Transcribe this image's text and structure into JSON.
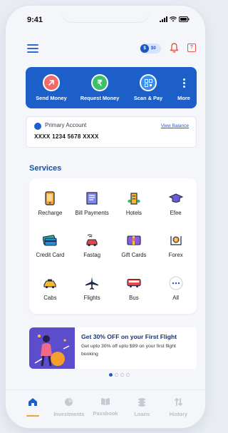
{
  "status_bar": {
    "time": "9:41"
  },
  "header": {
    "coin_balance": "$0"
  },
  "quick_actions": [
    {
      "label": "Send Money",
      "icon": "send-money-icon"
    },
    {
      "label": "Request Money",
      "icon": "request-money-icon"
    },
    {
      "label": "Scan & Pay",
      "icon": "scan-pay-icon"
    },
    {
      "label": "More",
      "icon": "more-icon"
    }
  ],
  "account": {
    "title": "Primary Account",
    "number": "XXXX 1234 5678 XXXX",
    "view_balance": "View Balance"
  },
  "services": {
    "title": "Services",
    "items": [
      {
        "label": "Recharge",
        "icon": "mobile-recharge-icon"
      },
      {
        "label": "Bill Payments",
        "icon": "bill-icon"
      },
      {
        "label": "Hotels",
        "icon": "hotel-icon"
      },
      {
        "label": "Efee",
        "icon": "graduation-cap-icon"
      },
      {
        "label": "Credit Card",
        "icon": "credit-card-icon"
      },
      {
        "label": "Fastag",
        "icon": "fastag-car-icon"
      },
      {
        "label": "Gift Cards",
        "icon": "gift-card-icon"
      },
      {
        "label": "Forex",
        "icon": "forex-icon"
      },
      {
        "label": "Cabs",
        "icon": "cab-icon"
      },
      {
        "label": "Flights",
        "icon": "airplane-icon"
      },
      {
        "label": "Bus",
        "icon": "bus-icon"
      },
      {
        "label": "All",
        "icon": "more-horizontal-icon"
      }
    ]
  },
  "promo": {
    "title": "Get 30% OFF on your First Flight",
    "description": "Get upto 30% off upto $99 on your first flight booking"
  },
  "carousel": {
    "count": 4,
    "active_index": 0
  },
  "tabs": [
    {
      "label": "",
      "icon": "home-icon",
      "active": true
    },
    {
      "label": "Investments",
      "icon": "investments-icon",
      "active": false
    },
    {
      "label": "Passbook",
      "icon": "passbook-icon",
      "active": false
    },
    {
      "label": "Loans",
      "icon": "loans-icon",
      "active": false
    },
    {
      "label": "History",
      "icon": "history-icon",
      "active": false
    }
  ],
  "colors": {
    "primary": "#1c5fc9",
    "accent": "#f2a23a",
    "title_blue": "#1a4fa8"
  }
}
